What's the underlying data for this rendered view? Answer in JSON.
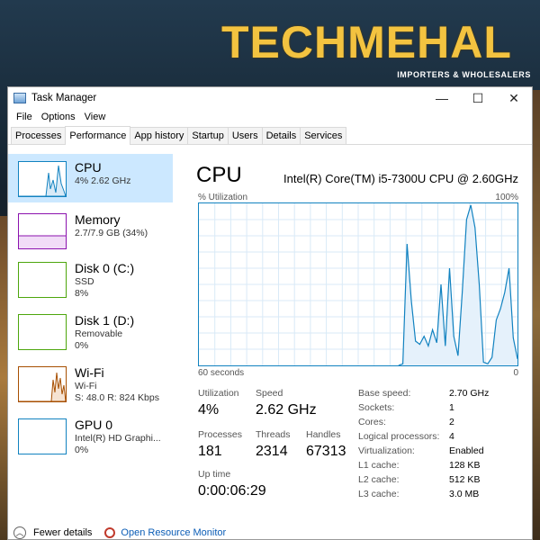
{
  "logo": {
    "word": "TECHMEHAL",
    "tagline": "IMPORTERS & WHOLESALERS"
  },
  "window": {
    "title": "Task Manager",
    "controls": [
      "—",
      "☐",
      "✕"
    ]
  },
  "menu": [
    "File",
    "Options",
    "View"
  ],
  "tabs": [
    "Processes",
    "Performance",
    "App history",
    "Startup",
    "Users",
    "Details",
    "Services"
  ],
  "active_tab": "Performance",
  "sidebar": {
    "items": [
      {
        "name": "CPU",
        "sub1": "4% 2.62 GHz",
        "sub2": "",
        "color": "#1182c0"
      },
      {
        "name": "Memory",
        "sub1": "2.7/7.9 GB (34%)",
        "sub2": "",
        "color": "#8b12ae"
      },
      {
        "name": "Disk 0 (C:)",
        "sub1": "SSD",
        "sub2": "8%",
        "color": "#4da60c"
      },
      {
        "name": "Disk 1 (D:)",
        "sub1": "Removable",
        "sub2": "0%",
        "color": "#4da60c"
      },
      {
        "name": "Wi-Fi",
        "sub1": "Wi-Fi",
        "sub2": "S: 48.0 R: 824 Kbps",
        "color": "#a74f01"
      },
      {
        "name": "GPU 0",
        "sub1": "Intel(R) HD Graphi...",
        "sub2": "0%",
        "color": "#1182c0"
      }
    ]
  },
  "main": {
    "title": "CPU",
    "model": "Intel(R) Core(TM) i5-7300U CPU @ 2.60GHz",
    "util_label": "% Utilization",
    "max_label": "100%",
    "secs_label": "60 seconds",
    "zero_label": "0",
    "stats": {
      "utilization_label": "Utilization",
      "utilization": "4%",
      "speed_label": "Speed",
      "speed": "2.62 GHz",
      "processes_label": "Processes",
      "processes": "181",
      "threads_label": "Threads",
      "threads": "2314",
      "handles_label": "Handles",
      "handles": "67313",
      "uptime_label": "Up time",
      "uptime": "0:00:06:29"
    },
    "specs": [
      {
        "label": "Base speed:",
        "value": "2.70 GHz"
      },
      {
        "label": "Sockets:",
        "value": "1"
      },
      {
        "label": "Cores:",
        "value": "2"
      },
      {
        "label": "Logical processors:",
        "value": "4"
      },
      {
        "label": "Virtualization:",
        "value": "Enabled"
      },
      {
        "label": "L1 cache:",
        "value": "128 KB"
      },
      {
        "label": "L2 cache:",
        "value": "512 KB"
      },
      {
        "label": "L3 cache:",
        "value": "3.0 MB"
      }
    ]
  },
  "footer": {
    "fewer": "Fewer details",
    "monitor": "Open Resource Monitor"
  },
  "cpu_graph": [
    0,
    0,
    0,
    0,
    0,
    0,
    0,
    0,
    0,
    0,
    0,
    0,
    0,
    0,
    0,
    0,
    0,
    0,
    0,
    0,
    0,
    0,
    0,
    0,
    0,
    0,
    0,
    0,
    0,
    0,
    0,
    0,
    0,
    0,
    0,
    0,
    0,
    0,
    0,
    0,
    0,
    0,
    0,
    0,
    0,
    0,
    0,
    0,
    1,
    75,
    40,
    15,
    13,
    18,
    12,
    22,
    14,
    50,
    12,
    60,
    18,
    6,
    45,
    90,
    99,
    85,
    50,
    2,
    1,
    5,
    28,
    35,
    45,
    60,
    17,
    4
  ],
  "colors": {
    "accent": "#1182c0",
    "selected": "#cce8ff",
    "graph_fill": "#e5f1fb"
  }
}
